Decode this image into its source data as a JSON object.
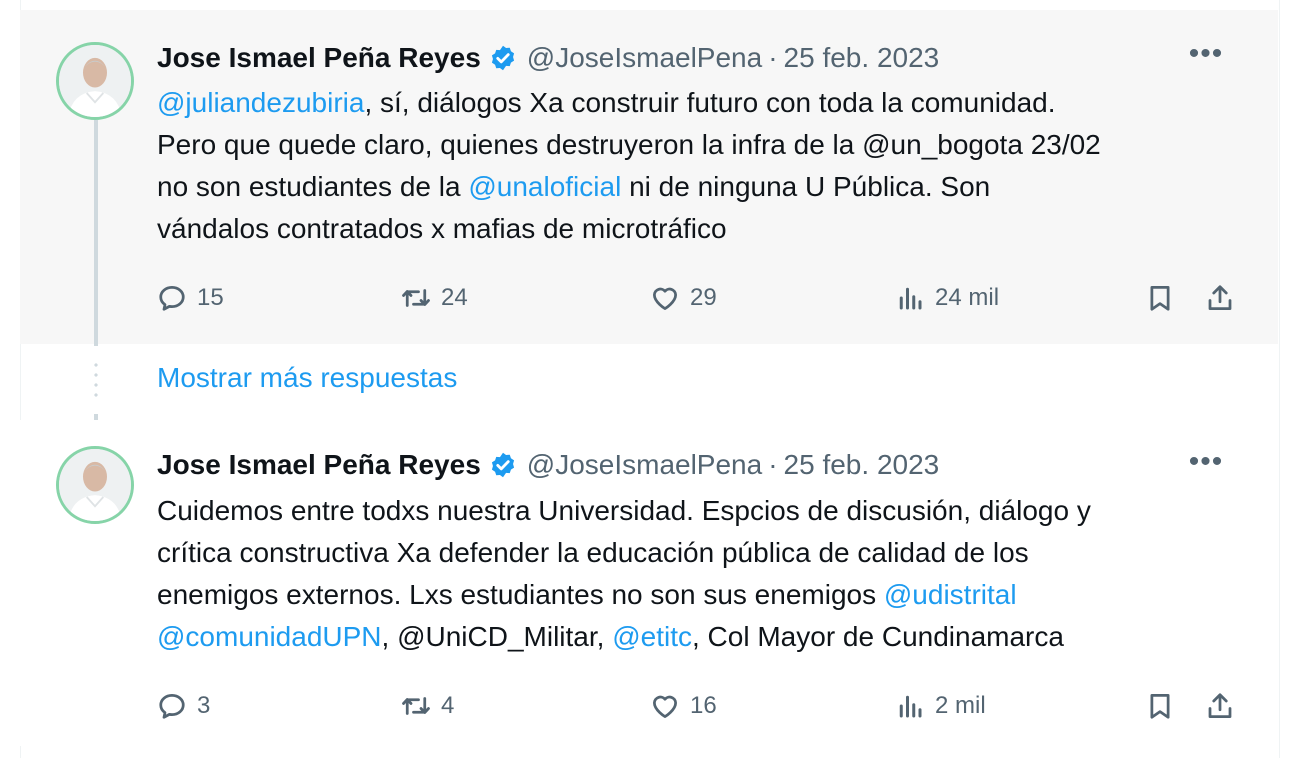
{
  "tweets": [
    {
      "name": "Jose Ismael Peña Reyes",
      "handle": "@JoseIsmaelPena",
      "separator": "·",
      "date": "25 feb. 2023",
      "more": "•••",
      "text_lines": [
        [
          {
            "t": "@juliandezubiria",
            "link": true
          },
          {
            "t": ", sí, diálogos Xa construir futuro con toda la comunidad.",
            "link": false
          }
        ],
        [
          {
            "t": "Pero que quede claro, quienes destruyeron la infra de la @un_bogota  23/02",
            "link": false
          }
        ],
        [
          {
            "t": "no son estudiantes de la ",
            "link": false
          },
          {
            "t": "@unaloficial",
            "link": true
          },
          {
            "t": " ni de ninguna U Pública. Son",
            "link": false
          }
        ],
        [
          {
            "t": "vándalos contratados x mafias de microtráfico",
            "link": false
          }
        ]
      ],
      "stats": {
        "replies": "15",
        "retweets": "24",
        "likes": "29",
        "views": "24 mil"
      }
    },
    {
      "name": "Jose Ismael Peña Reyes",
      "handle": "@JoseIsmaelPena",
      "separator": "·",
      "date": "25 feb. 2023",
      "more": "•••",
      "text_lines": [
        [
          {
            "t": "Cuidemos entre todxs nuestra Universidad. Espcios de discusión, diálogo y",
            "link": false
          }
        ],
        [
          {
            "t": "crítica constructiva Xa defender la educación pública de calidad de los",
            "link": false
          }
        ],
        [
          {
            "t": "enemigos externos.  Lxs estudiantes no son sus enemigos ",
            "link": false
          },
          {
            "t": "@udistrital",
            "link": true
          }
        ],
        [
          {
            "t": "@comunidadUPN",
            "link": true
          },
          {
            "t": ", @UniCD_Militar, ",
            "link": false
          },
          {
            "t": "@etitc",
            "link": true
          },
          {
            "t": ", Col Mayor de Cundinamarca",
            "link": false
          }
        ]
      ],
      "stats": {
        "replies": "3",
        "retweets": "4",
        "likes": "16",
        "views": "2 mil"
      }
    }
  ],
  "show_more_replies": "Mostrar más respuestas",
  "icons": {
    "reply": "reply-icon",
    "retweet": "retweet-icon",
    "like": "heart-icon",
    "views": "views-icon",
    "bookmark": "bookmark-icon",
    "share": "share-icon",
    "verified": "verified-badge-icon",
    "more": "more-icon"
  },
  "colors": {
    "link": "#1d9bf0",
    "muted": "#536471",
    "text": "#0f1419",
    "verified": "#1d9bf0",
    "avatar_ring": "#86d4a8",
    "highlight_bg": "#f7f7f7"
  }
}
